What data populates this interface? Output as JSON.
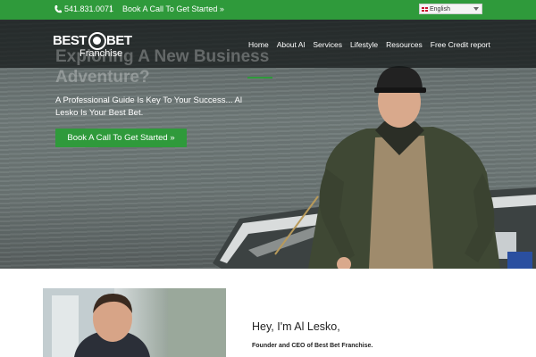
{
  "topbar": {
    "phone": "541.831.0071",
    "separator": "|",
    "call_link": "Book A Call To Get Started »",
    "language": "English"
  },
  "header": {
    "logo_best": "BEST",
    "logo_bet": "BET",
    "logo_franchise": "Franchise",
    "nav": [
      "Home",
      "About Al",
      "Services",
      "Lifestyle",
      "Resources",
      "Free Credit report"
    ]
  },
  "hero": {
    "title": "Exploring A New Business Adventure?",
    "subtitle": "A Professional Guide Is Key To Your Success... Al Lesko Is Your Best Bet.",
    "cta": "Book A Call To Get Started »"
  },
  "intro": {
    "greeting": "Hey, I'm Al Lesko,",
    "role": "Founder and CEO of Best Bet Franchise."
  },
  "colors": {
    "brand_green": "#2f9a3b",
    "hero_water": "#6b7574"
  }
}
